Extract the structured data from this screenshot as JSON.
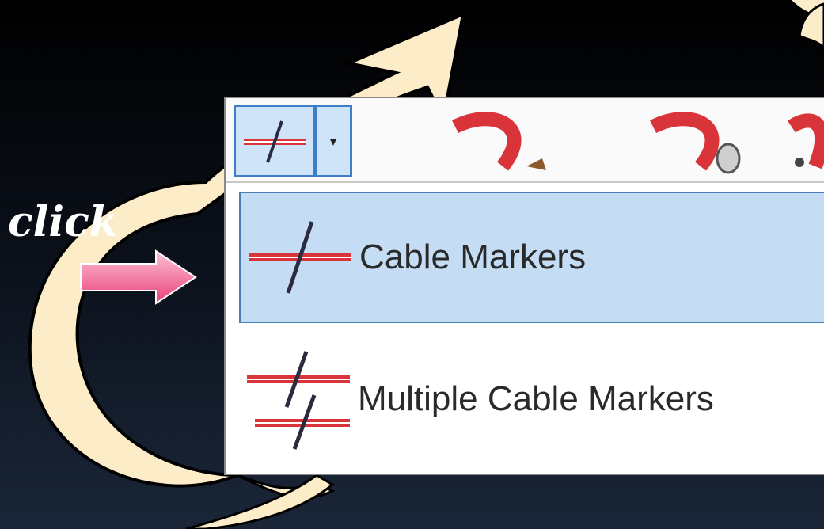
{
  "annotation": {
    "click_label": "click"
  },
  "toolbar": {
    "split_button_icon": "cable-marker-icon",
    "split_button_arrow": "▾",
    "tools": [
      "cable-tool-icon",
      "cable-tool-mouse-icon",
      "cable-tool-connect-icon"
    ]
  },
  "menu": {
    "items": [
      {
        "label": "Cable Markers",
        "icon": "cable-marker-icon",
        "highlighted": true
      },
      {
        "label": "Multiple Cable Markers",
        "icon": "multiple-cable-markers-icon",
        "highlighted": false
      }
    ]
  },
  "colors": {
    "highlight": "#c4dcf4",
    "highlight_border": "#4a7eb4",
    "arrow_cream": "#fdecc8",
    "pointer_pink": "#e8417a",
    "cable_red": "#d8343a"
  }
}
